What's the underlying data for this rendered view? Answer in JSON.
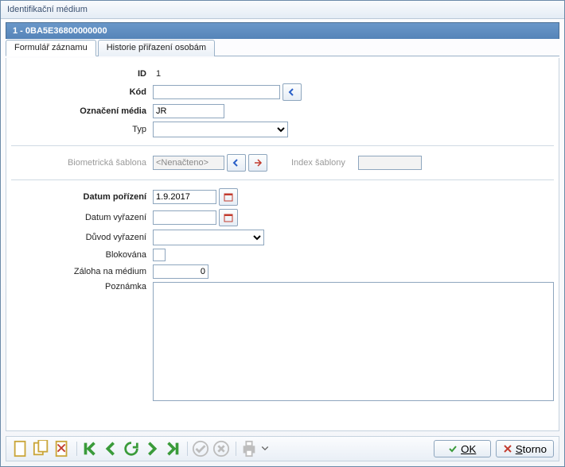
{
  "window_title": "Identifikační médium",
  "record_hdr": "1   -   0BA5E36800000000",
  "tabs": {
    "form": "Formulář záznamu",
    "history": "Historie přiřazení osobám"
  },
  "fields": {
    "id_label": "ID",
    "id_value": "1",
    "kod_label": "Kód",
    "kod_value": "0BA5E36800000000",
    "ozn_label": "Označení média",
    "ozn_value": "JR",
    "typ_label": "Typ",
    "typ_value": "",
    "bio_label": "Biometrická šablona",
    "bio_value": "<Nenačteno>",
    "idxsab_label": "Index šablony",
    "idxsab_value": "",
    "datpor_label": "Datum pořízení",
    "datpor_value": "1.9.2017",
    "datvyr_label": "Datum vyřazení",
    "datvyr_value": "",
    "duvod_label": "Důvod vyřazení",
    "duvod_value": "",
    "blok_label": "Blokována",
    "zaloha_label": "Záloha na médium",
    "zaloha_value": "0",
    "pozn_label": "Poznámka",
    "pozn_value": ""
  },
  "buttons": {
    "ok": "OK",
    "storno": "Storno"
  },
  "icons": {
    "arrow_left": "arrow-left-icon",
    "arrow_refresh": "refresh-icon",
    "arrow_clear": "clear-icon",
    "calendar": "calendar-icon"
  },
  "colors": {
    "accent": "#5584b8",
    "selection": "#2a60c8",
    "ok": "#3a9b3a",
    "cancel": "#c23b2e"
  }
}
